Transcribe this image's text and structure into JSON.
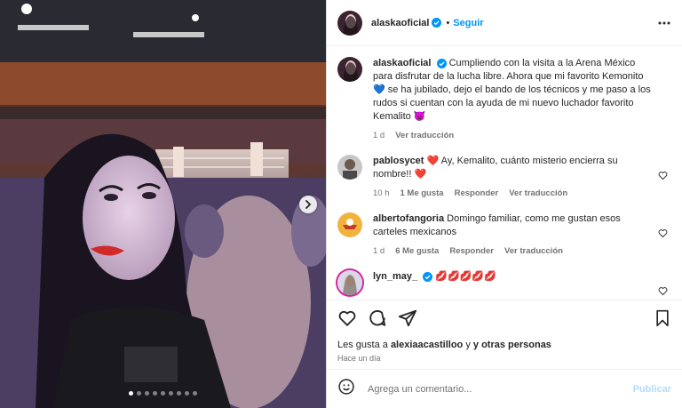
{
  "post": {
    "author": "alaskaoficial",
    "follow_label": "Seguir",
    "separator": "•"
  },
  "caption": {
    "author": "alaskaoficial",
    "text": "Cumpliendo con la visita a la Arena México para disfrutar de la lucha libre. Ahora que mi favorito Kemonito 💙 se ha jubilado, dejo el bando de los técnicos y me paso a los rudos si cuentan con la ayuda de mi nuevo luchador favorito Kemalito 👿",
    "time": "1 d",
    "translate": "Ver traducción"
  },
  "comments": [
    {
      "user": "pablosycet",
      "text": "❤️ Ay, Kemalito, cuánto misterio encierra su nombre!! ❤️",
      "time": "10 h",
      "likes": "1 Me gusta",
      "reply": "Responder",
      "translate": "Ver traducción"
    },
    {
      "user": "albertofangoria",
      "text": "Domingo familiar, como me gustan esos carteles mexicanos",
      "time": "1 d",
      "likes": "6 Me gusta",
      "reply": "Responder",
      "translate": "Ver traducción"
    },
    {
      "user": "lyn_may_",
      "text": "💋💋💋💋💋"
    }
  ],
  "likes": {
    "prefix": "Les gusta a",
    "user": "alexiaacastilloo",
    "suffix": "y otras personas"
  },
  "timestamp": "Hace un día",
  "add_comment": {
    "placeholder": "Agrega un comentario...",
    "publish": "Publicar"
  },
  "carousel": {
    "count": 9,
    "current": 1
  },
  "colors": {
    "accent": "#0095f6",
    "verified": "#0095f6",
    "text": "#262626",
    "muted": "#737373"
  },
  "icons": [
    "verified-badge-icon",
    "more-options-icon",
    "like-icon",
    "comment-icon",
    "share-icon",
    "bookmark-icon",
    "emoji-icon",
    "next-arrow-icon"
  ]
}
